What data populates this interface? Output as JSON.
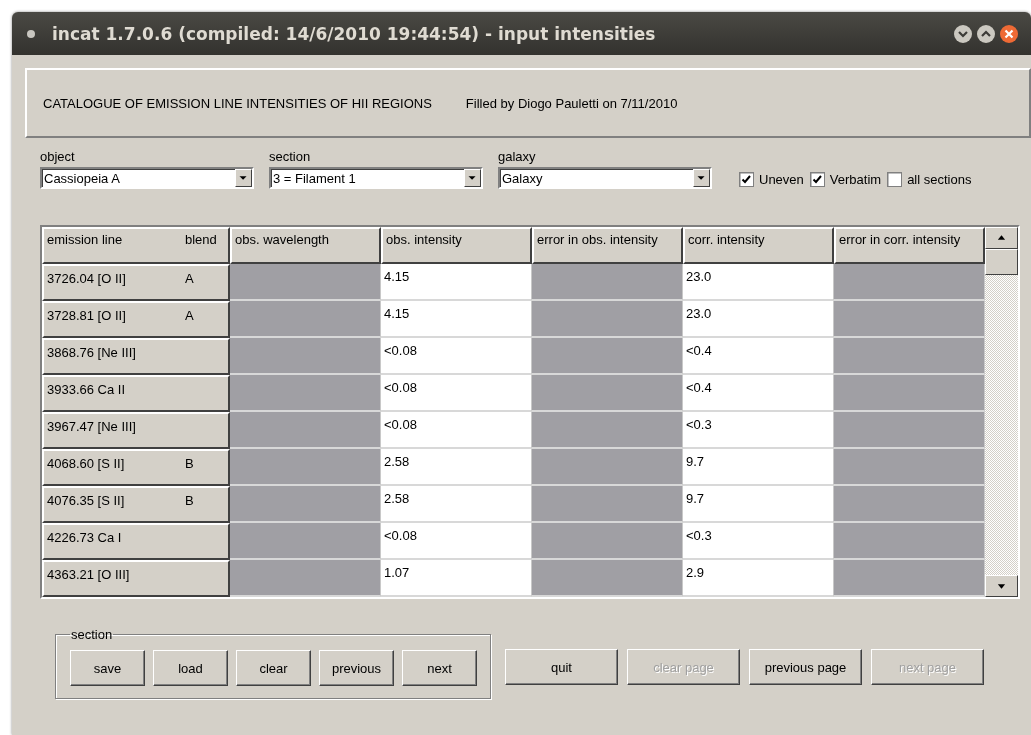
{
  "window": {
    "title": "incat 1.7.0.6 (compiled: 14/6/2010 19:44:54) - input intensities"
  },
  "header": {
    "title": "CATALOGUE OF EMISSION LINE INTENSITIES OF HII REGIONS",
    "filled_by": "Filled by Diogo Pauletti on 7/11/2010"
  },
  "selectors": [
    {
      "label": "object",
      "value": "Cassiopeia A"
    },
    {
      "label": "section",
      "value": "3 = Filament 1"
    },
    {
      "label": "galaxy",
      "value": "Galaxy"
    }
  ],
  "options": [
    {
      "label": "Uneven",
      "checked": true
    },
    {
      "label": "Verbatim",
      "checked": true
    },
    {
      "label": "all sections",
      "checked": false
    }
  ],
  "table": {
    "columns": [
      "emission line",
      "blend",
      "obs. wavelength",
      "obs. intensity",
      "error in obs. intensity",
      "corr. intensity",
      "error in corr. intensity"
    ],
    "rows": [
      {
        "cells": [
          {
            "kind": "label",
            "text": "3726.04 [O II]"
          },
          {
            "kind": "label",
            "text": "A"
          },
          {
            "kind": "disabled"
          },
          {
            "kind": "input",
            "text": "4.15"
          },
          {
            "kind": "disabled"
          },
          {
            "kind": "input",
            "text": "23.0"
          },
          {
            "kind": "disabled"
          }
        ]
      },
      {
        "cells": [
          {
            "kind": "label",
            "text": "3728.81 [O II]"
          },
          {
            "kind": "label",
            "text": "A"
          },
          {
            "kind": "disabled"
          },
          {
            "kind": "input",
            "text": "4.15"
          },
          {
            "kind": "disabled"
          },
          {
            "kind": "input",
            "text": "23.0"
          },
          {
            "kind": "disabled"
          }
        ]
      },
      {
        "cells": [
          {
            "kind": "label",
            "text": "3868.76 [Ne III]"
          },
          {
            "kind": "label"
          },
          {
            "kind": "disabled"
          },
          {
            "kind": "input",
            "text": "<0.08"
          },
          {
            "kind": "disabled"
          },
          {
            "kind": "input",
            "text": "<0.4"
          },
          {
            "kind": "disabled"
          }
        ]
      },
      {
        "cells": [
          {
            "kind": "label",
            "text": "3933.66 Ca II"
          },
          {
            "kind": "label"
          },
          {
            "kind": "disabled"
          },
          {
            "kind": "input",
            "text": "<0.08"
          },
          {
            "kind": "disabled"
          },
          {
            "kind": "input",
            "text": "<0.4"
          },
          {
            "kind": "disabled"
          }
        ]
      },
      {
        "cells": [
          {
            "kind": "label",
            "text": "3967.47 [Ne III]"
          },
          {
            "kind": "label"
          },
          {
            "kind": "disabled"
          },
          {
            "kind": "input",
            "text": "<0.08"
          },
          {
            "kind": "disabled"
          },
          {
            "kind": "input",
            "text": "<0.3"
          },
          {
            "kind": "disabled"
          }
        ]
      },
      {
        "cells": [
          {
            "kind": "label",
            "text": "4068.60 [S II]"
          },
          {
            "kind": "label",
            "text": "B"
          },
          {
            "kind": "disabled"
          },
          {
            "kind": "input",
            "text": "2.58"
          },
          {
            "kind": "disabled"
          },
          {
            "kind": "input",
            "text": "9.7"
          },
          {
            "kind": "disabled"
          }
        ]
      },
      {
        "cells": [
          {
            "kind": "label",
            "text": "4076.35 [S II]"
          },
          {
            "kind": "label",
            "text": "B"
          },
          {
            "kind": "disabled"
          },
          {
            "kind": "input",
            "text": "2.58"
          },
          {
            "kind": "disabled"
          },
          {
            "kind": "input",
            "text": "9.7"
          },
          {
            "kind": "disabled"
          }
        ]
      },
      {
        "cells": [
          {
            "kind": "label",
            "text": "4226.73 Ca I"
          },
          {
            "kind": "label"
          },
          {
            "kind": "disabled"
          },
          {
            "kind": "input",
            "text": "<0.08"
          },
          {
            "kind": "disabled"
          },
          {
            "kind": "input",
            "text": "<0.3"
          },
          {
            "kind": "disabled"
          }
        ]
      },
      {
        "cells": [
          {
            "kind": "label",
            "text": "4363.21 [O III]"
          },
          {
            "kind": "label"
          },
          {
            "kind": "disabled"
          },
          {
            "kind": "input",
            "text": "1.07"
          },
          {
            "kind": "disabled"
          },
          {
            "kind": "input",
            "text": "2.9"
          },
          {
            "kind": "disabled"
          }
        ]
      }
    ]
  },
  "section_group": {
    "title": "section",
    "buttons": [
      {
        "label": "save",
        "disabled": false
      },
      {
        "label": "load",
        "disabled": false
      },
      {
        "label": "clear",
        "disabled": false
      },
      {
        "label": "previous",
        "disabled": false
      },
      {
        "label": "next",
        "disabled": false
      }
    ]
  },
  "buttons": [
    {
      "label": "quit",
      "disabled": false
    },
    {
      "label": "clear page",
      "disabled": true
    },
    {
      "label": "previous page",
      "disabled": false
    },
    {
      "label": "next page",
      "disabled": true
    }
  ]
}
